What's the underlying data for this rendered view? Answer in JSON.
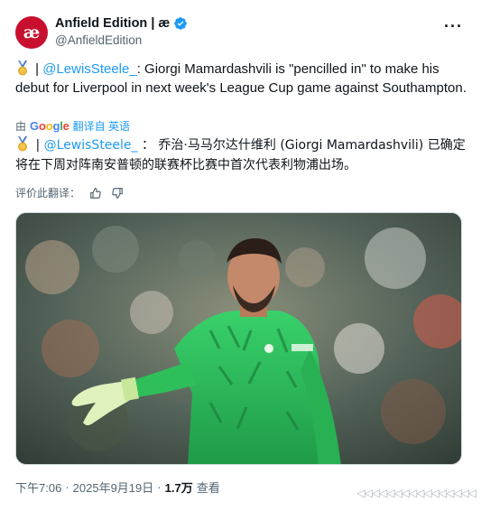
{
  "account": {
    "avatar_letter": "æ",
    "display_name": "Anfield Edition | æ",
    "handle": "@AnfieldEdition",
    "verified": true,
    "brand_color": "#c8102e"
  },
  "tweet": {
    "separator": " | ",
    "mention": "@LewisSteele_",
    "text": ": Giorgi Mamardashvili is \"pencilled in\" to make his debut for Liverpool in next week's League Cup game against Southampton."
  },
  "translation": {
    "by": "由",
    "provider": "Google",
    "translated_from": "翻译自 英语",
    "separator": " | ",
    "mention": "@LewisSteele_",
    "text": " ： 乔治·马马尔达什维利 (Giorgi Mamardashvili) 已确定将在下周对阵南安普顿的联赛杯比赛中首次代表利物浦出场。",
    "rate_label": "评价此翻译："
  },
  "meta": {
    "time": "下午7:06",
    "dot1": "·",
    "date": "2025年9月19日",
    "dot2": "·",
    "views_count": "1.7万",
    "views_label": "查看"
  },
  "colors": {
    "link": "#1d9bf0",
    "secondary_text": "#536471",
    "verified": "#1d9bf0",
    "jersey": "#2fbf5a"
  }
}
